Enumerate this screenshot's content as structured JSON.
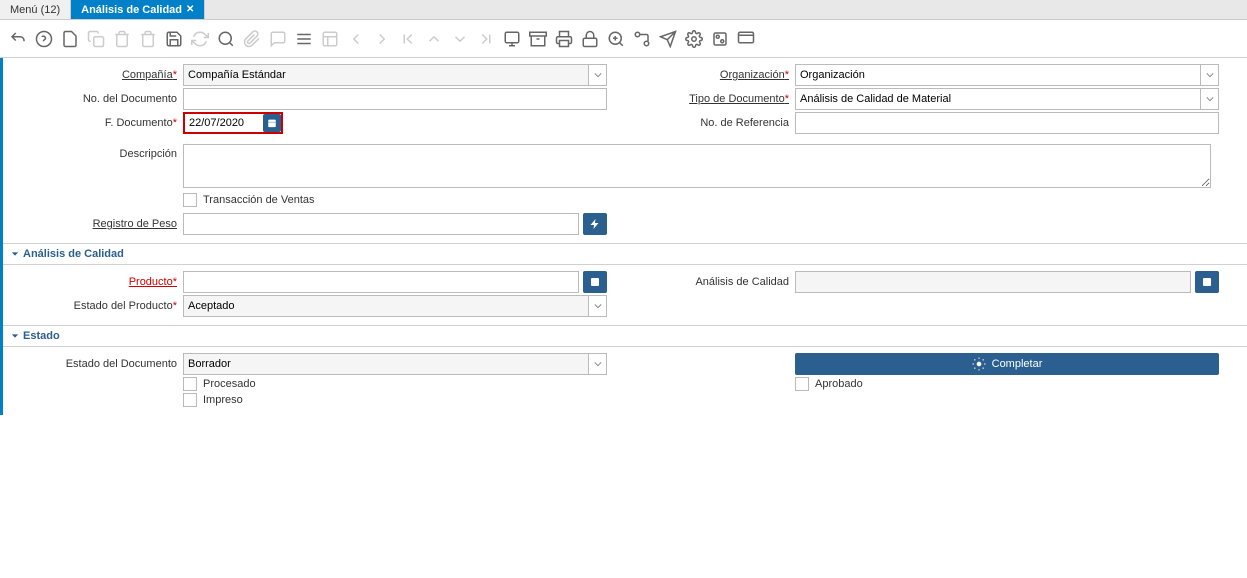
{
  "tabs": {
    "menu": "Menú (12)",
    "active": "Análisis de Calidad"
  },
  "form": {
    "compania": {
      "label": "Compañía",
      "value": "Compañía Estándar"
    },
    "organizacion": {
      "label": "Organización",
      "value": "Organización"
    },
    "no_documento": {
      "label": "No. del Documento",
      "value": ""
    },
    "tipo_documento": {
      "label": "Tipo de Documento",
      "value": "Análisis de Calidad de Material"
    },
    "f_documento": {
      "label": "F. Documento",
      "value": "22/07/2020"
    },
    "no_referencia": {
      "label": "No. de Referencia",
      "value": ""
    },
    "descripcion": {
      "label": "Descripción",
      "value": ""
    },
    "trans_ventas": {
      "label": "Transacción de Ventas"
    },
    "registro_peso": {
      "label": "Registro de Peso",
      "value": ""
    }
  },
  "section_calidad": {
    "title": "Análisis de Calidad",
    "producto": {
      "label": "Producto",
      "value": ""
    },
    "analisis": {
      "label": "Análisis de Calidad",
      "value": ""
    },
    "estado_producto": {
      "label": "Estado del Producto",
      "value": "Aceptado"
    }
  },
  "section_estado": {
    "title": "Estado",
    "estado_doc": {
      "label": "Estado del Documento",
      "value": "Borrador"
    },
    "completar": "Completar",
    "procesado": "Procesado",
    "aprobado": "Aprobado",
    "impreso": "Impreso"
  }
}
